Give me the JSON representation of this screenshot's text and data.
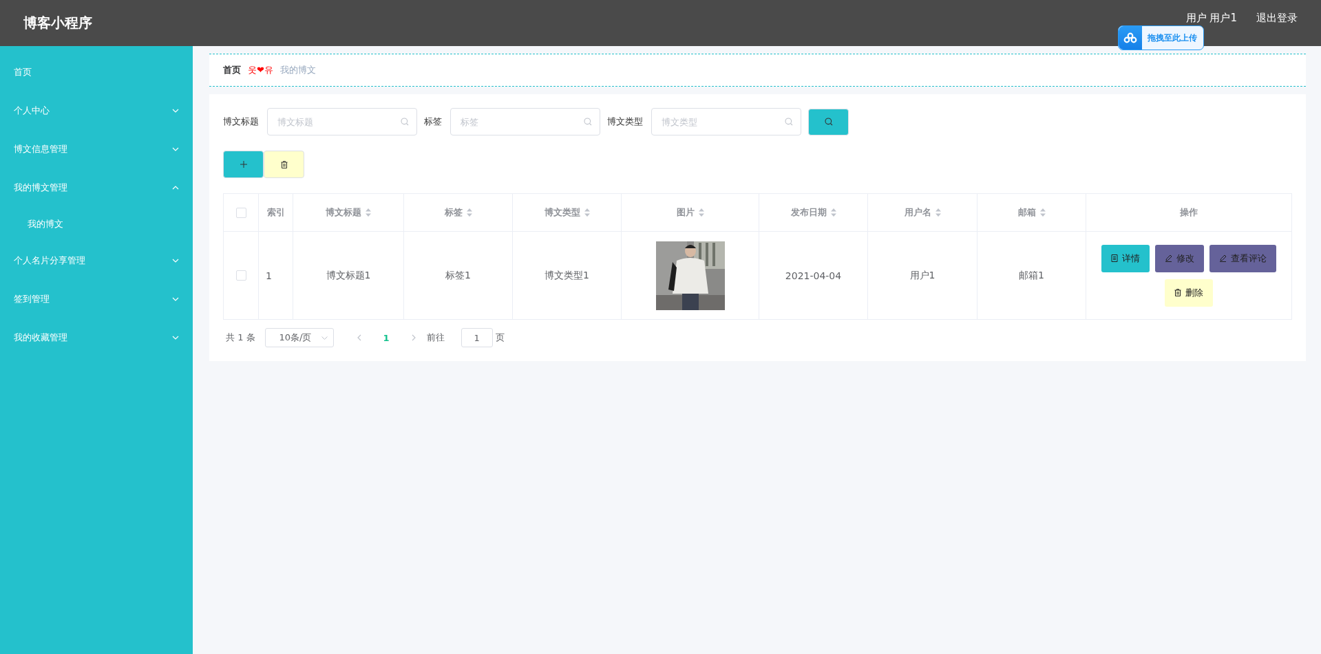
{
  "header": {
    "title": "博客小程序",
    "user": "用户 用户1",
    "logout": "退出登录",
    "upload_badge": "拖拽至此上传"
  },
  "sidebar": {
    "items": [
      {
        "label": "首页",
        "kind": "link"
      },
      {
        "label": "个人中心",
        "kind": "group",
        "expanded": false
      },
      {
        "label": "博文信息管理",
        "kind": "group",
        "expanded": false
      },
      {
        "label": "我的博文管理",
        "kind": "group",
        "expanded": true,
        "children": [
          {
            "label": "我的博文"
          }
        ]
      },
      {
        "label": "个人名片分享管理",
        "kind": "group",
        "expanded": false
      },
      {
        "label": "签到管理",
        "kind": "group",
        "expanded": false
      },
      {
        "label": "我的收藏管理",
        "kind": "group",
        "expanded": false
      }
    ]
  },
  "breadcrumb": {
    "home": "首页",
    "separator": "웃❤유",
    "current": "我的博文"
  },
  "search": {
    "fields": [
      {
        "label": "博文标题",
        "placeholder": "博文标题"
      },
      {
        "label": "标签",
        "placeholder": "标签"
      },
      {
        "label": "博文类型",
        "placeholder": "博文类型"
      }
    ]
  },
  "table": {
    "columns": [
      {
        "label": "索引",
        "sortable": false
      },
      {
        "label": "博文标题",
        "sortable": true
      },
      {
        "label": "标签",
        "sortable": true
      },
      {
        "label": "博文类型",
        "sortable": true
      },
      {
        "label": "图片",
        "sortable": true
      },
      {
        "label": "发布日期",
        "sortable": true
      },
      {
        "label": "用户名",
        "sortable": true
      },
      {
        "label": "邮箱",
        "sortable": true
      },
      {
        "label": "操作",
        "sortable": false
      }
    ],
    "header_checked": false,
    "rows": [
      {
        "checked": false,
        "cells": [
          "1",
          "博文标题1",
          "标签1",
          "博文类型1",
          {
            "kind": "picture"
          },
          "2021-04-04",
          "用户1",
          "邮箱1"
        ],
        "actions": [
          {
            "label": "详情",
            "kind": "detail"
          },
          {
            "label": "修改",
            "kind": "edit"
          },
          {
            "label": "查看评论",
            "kind": "edit"
          },
          {
            "label": "删除",
            "kind": "delete"
          }
        ]
      }
    ]
  },
  "pagination": {
    "total": "共 1 条",
    "page_size": "10条/页",
    "pages": [
      {
        "label": "1",
        "selected": true
      }
    ],
    "goto_label": "前往",
    "goto_value": "1",
    "goto_suffix": "页"
  }
}
